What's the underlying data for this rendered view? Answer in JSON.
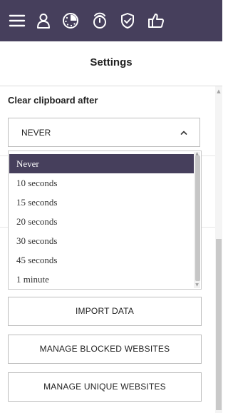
{
  "nav": {
    "icons": [
      "menu-icon",
      "user-icon",
      "clock-dial-icon",
      "stopwatch-icon",
      "shield-check-icon",
      "thumbs-up-icon"
    ]
  },
  "header": {
    "title": "Settings"
  },
  "clipboard": {
    "label": "Clear clipboard after",
    "selected_value": "NEVER",
    "options": [
      "Never",
      "10 seconds",
      "15 seconds",
      "20 seconds",
      "30 seconds",
      "45 seconds",
      "1 minute"
    ],
    "highlighted_index": 0
  },
  "buttons": {
    "import": "IMPORT DATA",
    "blocked": "MANAGE BLOCKED WEBSITES",
    "unique": "MANAGE UNIQUE WEBSITES"
  },
  "colors": {
    "topbar": "#463f5c",
    "highlight": "#463f5c"
  }
}
